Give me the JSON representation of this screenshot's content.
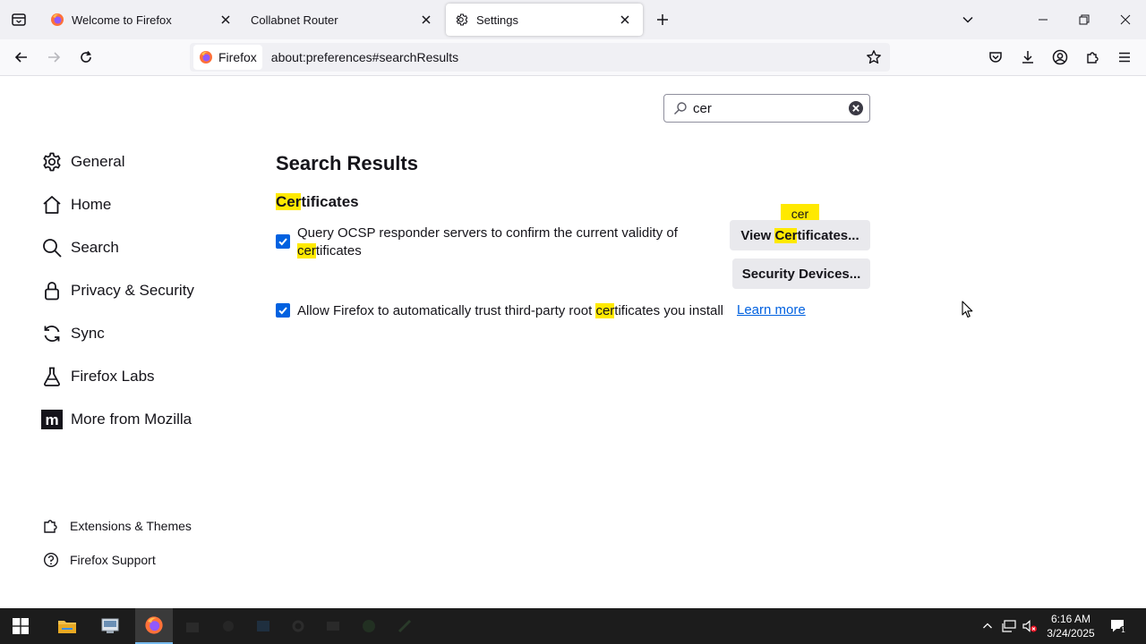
{
  "tabs": [
    {
      "label": "Welcome to Firefox",
      "close": "×"
    },
    {
      "label": "Collabnet Router",
      "close": "×"
    },
    {
      "label": "Settings",
      "close": "×"
    }
  ],
  "navigation": {
    "identity_label": "Firefox",
    "url": "about:preferences#searchResults"
  },
  "search": {
    "value": "cer"
  },
  "sidebar": {
    "categories": [
      {
        "label": "General",
        "icon": "gear-icon"
      },
      {
        "label": "Home",
        "icon": "home-icon"
      },
      {
        "label": "Search",
        "icon": "search-icon"
      },
      {
        "label": "Privacy & Security",
        "icon": "lock-icon"
      },
      {
        "label": "Sync",
        "icon": "sync-icon"
      },
      {
        "label": "Firefox Labs",
        "icon": "flask-icon"
      },
      {
        "label": "More from Mozilla",
        "icon": "mozilla-icon"
      }
    ],
    "footer": [
      {
        "label": "Extensions & Themes",
        "icon": "puzzle-icon"
      },
      {
        "label": "Firefox Support",
        "icon": "help-icon"
      }
    ]
  },
  "main": {
    "heading": "Search Results",
    "section_title_hl": "Cer",
    "section_title_rest": "tificates",
    "ocsp": {
      "line1": "Query OCSP responder servers to confirm the current validity of",
      "line2_hl": "cer",
      "line2_rest": "tificates",
      "checked": true
    },
    "trust": {
      "before": "Allow Firefox to automatically trust third-party root ",
      "hl": "cer",
      "after": "tificates you install",
      "checked": true
    },
    "learn_more": "Learn more",
    "view_button": {
      "before": "View ",
      "hl": "Cer",
      "after": "tificates..."
    },
    "security_button": "Security Devices...",
    "tooltip": "cer"
  },
  "taskbar": {
    "time": "6:16 AM",
    "date": "3/24/2025"
  },
  "colors": {
    "accent": "#0061e0",
    "highlight": "#ffe900",
    "taskbar": "#1c1c1c"
  }
}
